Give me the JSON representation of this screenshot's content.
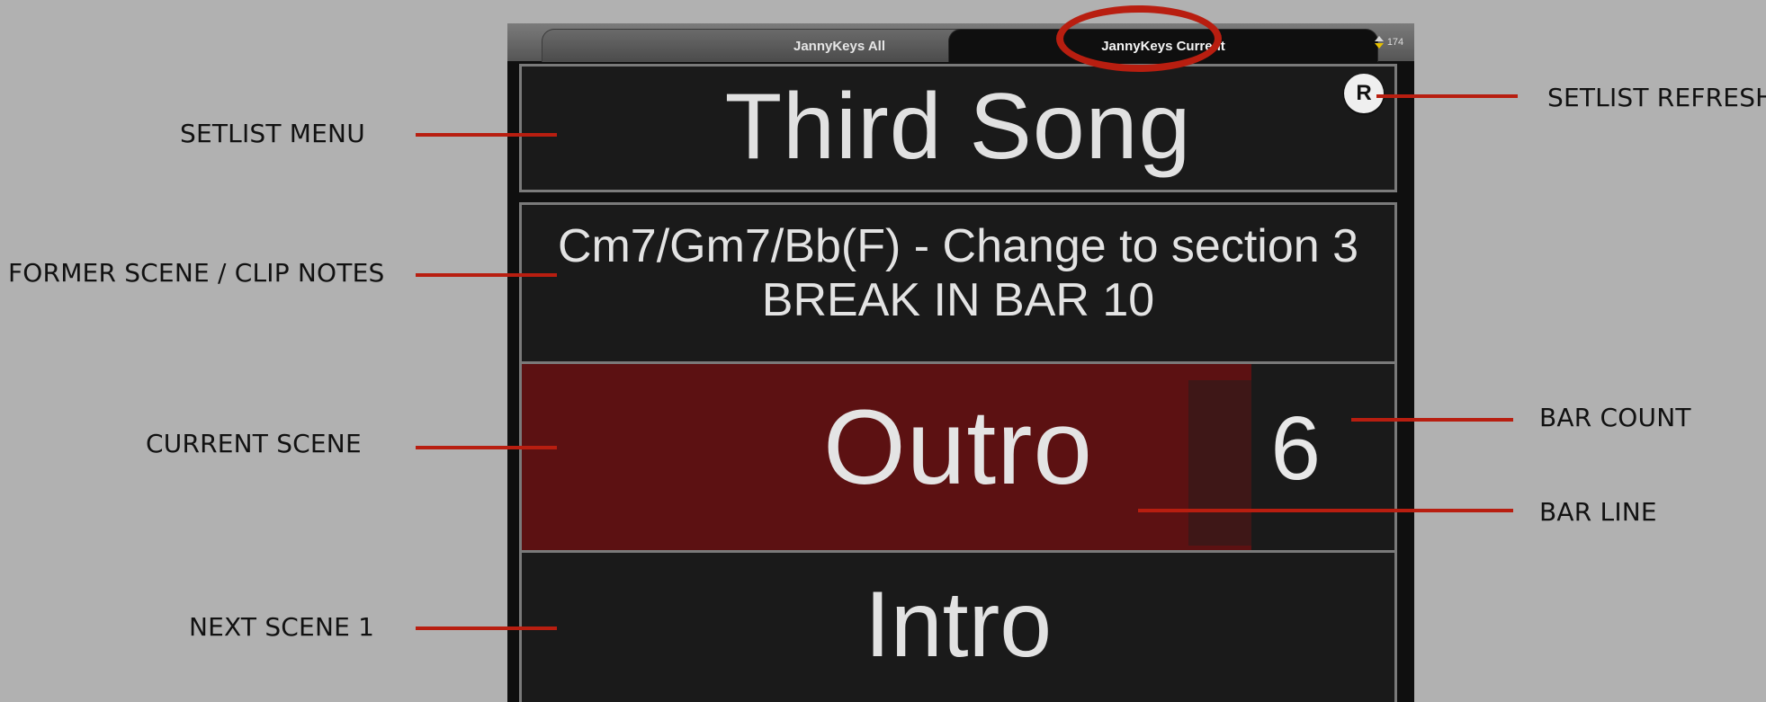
{
  "tabs": [
    {
      "label": "JannyKeys All"
    },
    {
      "label": "JannyKeys Current"
    }
  ],
  "tabbar": {
    "extra_label": "174"
  },
  "song": {
    "title": "Third Song",
    "refresh_label": "R"
  },
  "notes": {
    "line1": "Cm7/Gm7/Bb(F) - Change to section 3",
    "line2": "BREAK IN BAR 10"
  },
  "current_scene": {
    "name": "Outro",
    "bar_count": "6"
  },
  "next_scene": {
    "name": "Intro"
  },
  "annotations": {
    "setlist_menu": "SETLIST MENU",
    "former_scene_notes": "FORMER SCENE / CLIP NOTES",
    "current_scene": "CURRENT SCENE",
    "next_scene_1": "NEXT SCENE 1",
    "setlist_refresh": "SETLIST REFRESH",
    "bar_count": "BAR COUNT",
    "bar_line": "BAR LINE"
  },
  "colors": {
    "background": "#b1b1b1",
    "annotation_accent": "#b81e10",
    "screen_bg": "#0f0f0f",
    "progress_fill": "#5c1112"
  }
}
